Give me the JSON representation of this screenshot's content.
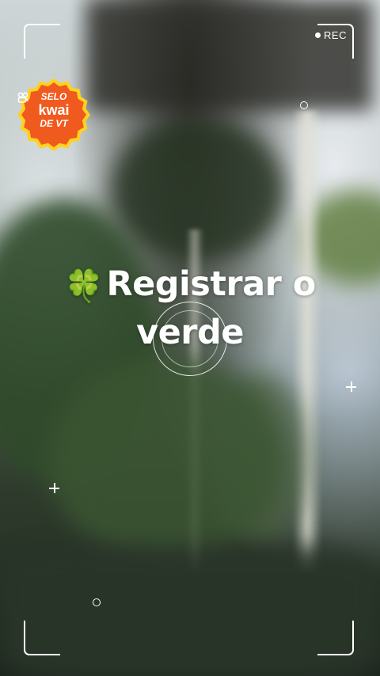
{
  "recording": {
    "label": "REC"
  },
  "badge": {
    "line1": "SELO",
    "brand": "kwai",
    "line3": "DE VT",
    "brand_icon": "kwai-camera-icon",
    "fill_color": "#f05a1e",
    "border_color": "#ffd21f"
  },
  "headline": {
    "emoji": "🍀",
    "text": "Registrar o verde"
  },
  "colors": {
    "overlay": "#ffffff"
  }
}
